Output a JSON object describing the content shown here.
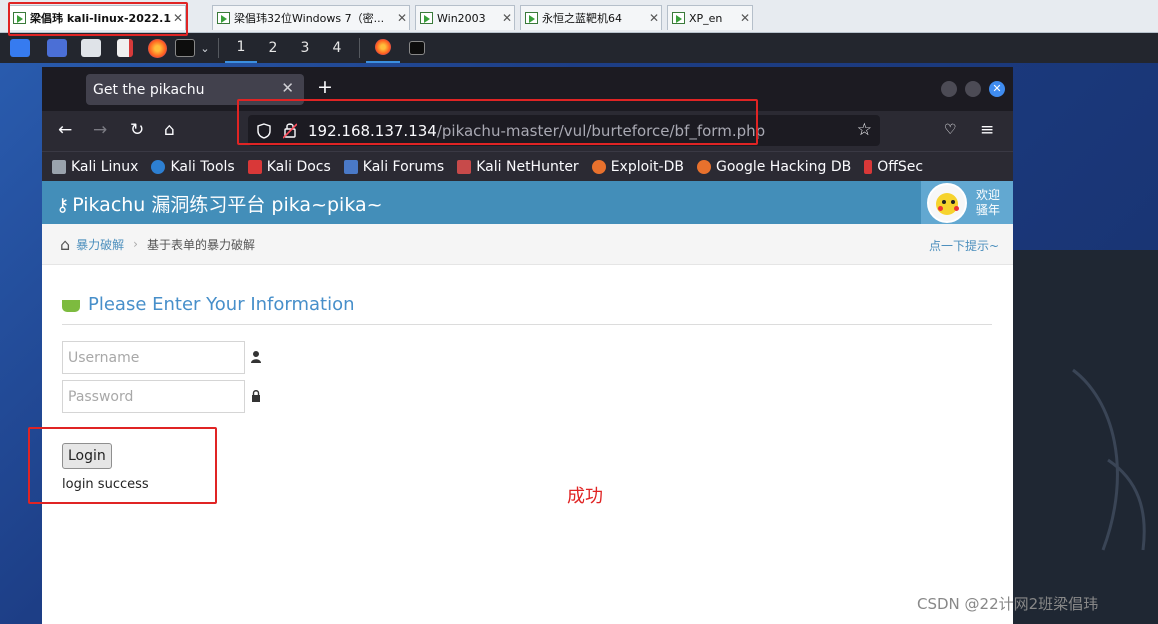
{
  "vm_tabs": [
    {
      "label": "梁倡玮  kali-linux-2022.1-..."
    },
    {
      "label": "梁倡玮32位Windows 7（密..."
    },
    {
      "label": "Win2003"
    },
    {
      "label": "永恒之蓝靶机64"
    },
    {
      "label": "XP_en"
    }
  ],
  "taskbar": {
    "workspaces": [
      "1",
      "2",
      "3",
      "4"
    ]
  },
  "browser": {
    "tab_title": "Get the pikachu",
    "url_host": "192.168.137.134",
    "url_path": "/pikachu-master/vul/burteforce/bf_form.php",
    "bookmarks": [
      {
        "label": "Kali Linux",
        "color": "#9aa3ad"
      },
      {
        "label": "Kali Tools",
        "color": "#2d7fd2"
      },
      {
        "label": "Kali Docs",
        "color": "#d93838"
      },
      {
        "label": "Kali Forums",
        "color": "#4a79c7"
      },
      {
        "label": "Kali NetHunter",
        "color": "#c74a4a"
      },
      {
        "label": "Exploit-DB",
        "color": "#e8712d"
      },
      {
        "label": "Google Hacking DB",
        "color": "#e8712d"
      },
      {
        "label": "OffSec",
        "color": "#d93838"
      }
    ]
  },
  "page": {
    "brand": "Pikachu 漏洞练习平台 pika~pika~",
    "welcome_line1": "欢迎",
    "welcome_line2": "骚年",
    "breadcrumb_parent": "暴力破解",
    "breadcrumb_current": "基于表单的暴力破解",
    "hint": "点一下提示~",
    "form_title": "Please Enter Your Information",
    "username_placeholder": "Username",
    "password_placeholder": "Password",
    "login_label": "Login",
    "login_message": "login success"
  },
  "annotation": {
    "success_label": "成功",
    "color": "#e02424"
  },
  "watermark": "CSDN @22计网2班梁倡玮"
}
